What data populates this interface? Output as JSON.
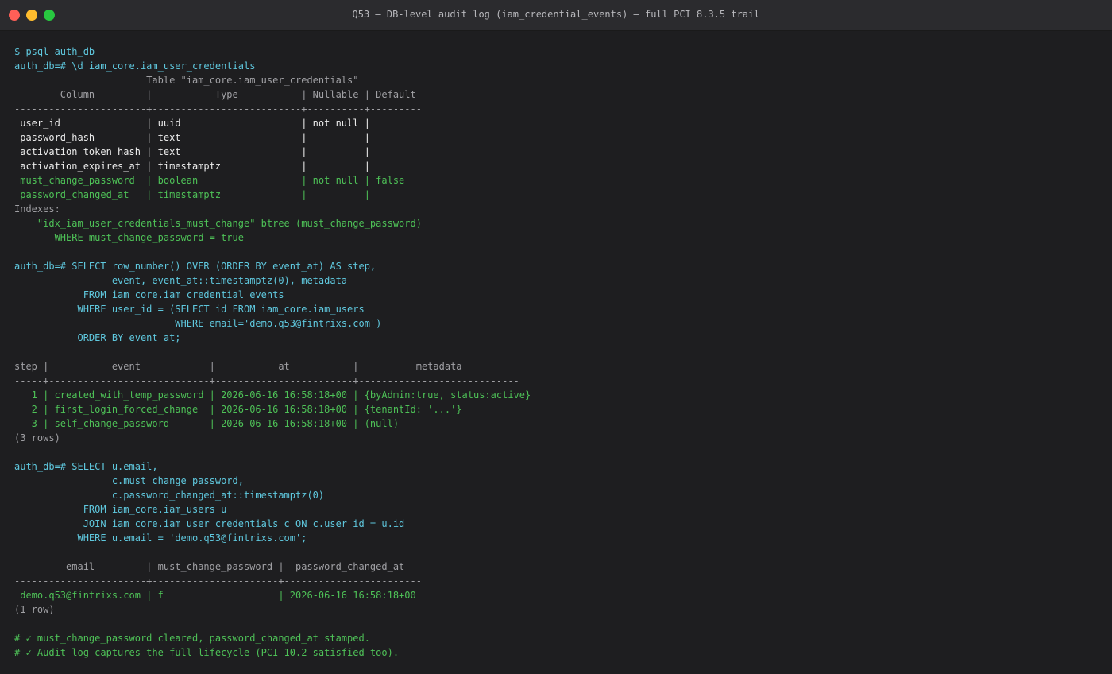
{
  "window": {
    "title": "Q53 — DB-level audit log (iam_credential_events) — full PCI 8.3.5 trail"
  },
  "terminal_lines": [
    {
      "text": "$ psql auth_db",
      "color": "cmd"
    },
    {
      "text": "auth_db=# \\d iam_core.iam_user_credentials",
      "color": "cmd"
    },
    {
      "text": "                       Table \"iam_core.iam_user_credentials\"",
      "color": "gray"
    },
    {
      "text": "        Column         |           Type           | Nullable | Default",
      "color": "gray"
    },
    {
      "text": "-----------------------+--------------------------+----------+---------",
      "color": "gray"
    },
    {
      "text": " user_id               | uuid                     | not null |",
      "color": "white"
    },
    {
      "text": " password_hash         | text                     |          |",
      "color": "white"
    },
    {
      "text": " activation_token_hash | text                     |          |",
      "color": "white"
    },
    {
      "text": " activation_expires_at | timestamptz              |          |",
      "color": "white"
    },
    {
      "text": " must_change_password  | boolean                  | not null | false",
      "color": "green"
    },
    {
      "text": " password_changed_at   | timestamptz              |          |",
      "color": "green"
    },
    {
      "text": "Indexes:",
      "color": "gray"
    },
    {
      "text": "    \"idx_iam_user_credentials_must_change\" btree (must_change_password)",
      "color": "green"
    },
    {
      "text": "       WHERE must_change_password = true",
      "color": "green"
    },
    {
      "text": "",
      "color": "gray"
    },
    {
      "text": "auth_db=# SELECT row_number() OVER (ORDER BY event_at) AS step,",
      "color": "cmd"
    },
    {
      "text": "                 event, event_at::timestamptz(0), metadata",
      "color": "cmd"
    },
    {
      "text": "            FROM iam_core.iam_credential_events",
      "color": "cmd"
    },
    {
      "text": "           WHERE user_id = (SELECT id FROM iam_core.iam_users",
      "color": "cmd"
    },
    {
      "text": "                            WHERE email='demo.q53@fintrixs.com')",
      "color": "cmd"
    },
    {
      "text": "           ORDER BY event_at;",
      "color": "cmd"
    },
    {
      "text": "",
      "color": "gray"
    },
    {
      "text": "step |           event            |           at           |          metadata",
      "color": "gray"
    },
    {
      "text": "-----+----------------------------+------------------------+----------------------------",
      "color": "gray"
    },
    {
      "text": "   1 | created_with_temp_password | 2026-06-16 16:58:18+00 | {byAdmin:true, status:active}",
      "color": "green"
    },
    {
      "text": "   2 | first_login_forced_change  | 2026-06-16 16:58:18+00 | {tenantId: '...'}",
      "color": "green"
    },
    {
      "text": "   3 | self_change_password       | 2026-06-16 16:58:18+00 | (null)",
      "color": "green"
    },
    {
      "text": "(3 rows)",
      "color": "gray"
    },
    {
      "text": "",
      "color": "gray"
    },
    {
      "text": "auth_db=# SELECT u.email,",
      "color": "cmd"
    },
    {
      "text": "                 c.must_change_password,",
      "color": "cmd"
    },
    {
      "text": "                 c.password_changed_at::timestamptz(0)",
      "color": "cmd"
    },
    {
      "text": "            FROM iam_core.iam_users u",
      "color": "cmd"
    },
    {
      "text": "            JOIN iam_core.iam_user_credentials c ON c.user_id = u.id",
      "color": "cmd"
    },
    {
      "text": "           WHERE u.email = 'demo.q53@fintrixs.com';",
      "color": "cmd"
    },
    {
      "text": "",
      "color": "gray"
    },
    {
      "text": "         email         | must_change_password |  password_changed_at",
      "color": "gray"
    },
    {
      "text": "-----------------------+----------------------+------------------------",
      "color": "gray"
    },
    {
      "text": " demo.q53@fintrixs.com | f                    | 2026-06-16 16:58:18+00",
      "color": "green"
    },
    {
      "text": "(1 row)",
      "color": "gray"
    },
    {
      "text": "",
      "color": "gray"
    },
    {
      "text": "# ✓ must_change_password cleared, password_changed_at stamped.",
      "color": "green"
    },
    {
      "text": "# ✓ Audit log captures the full lifecycle (PCI 10.2 satisfied too).",
      "color": "green"
    }
  ]
}
